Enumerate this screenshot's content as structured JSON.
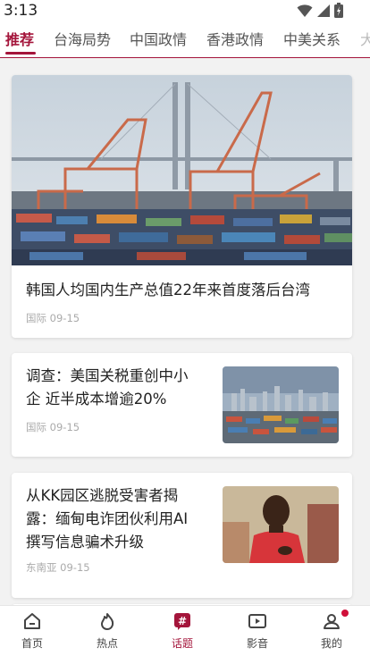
{
  "status": {
    "time": "3:13"
  },
  "tabs": [
    {
      "label": "推荐"
    },
    {
      "label": "台海局势"
    },
    {
      "label": "中国政情"
    },
    {
      "label": "香港政情"
    },
    {
      "label": "中美关系"
    },
    {
      "label": "大"
    }
  ],
  "articles": [
    {
      "title": "韩国人均国内生产总值22年来首度落后台湾",
      "category": "国际",
      "date": "09-15"
    },
    {
      "title_line1": "调查：美国关税重创中小",
      "title_line2": "企 近半成本增逾20%",
      "category": "国际",
      "date": "09-15"
    },
    {
      "title_line1": "从KK园区逃脱受害者揭",
      "title_line2": "露：缅甸电诈团伙利用AI",
      "title_line3": "撰写信息骗术升级",
      "category": "东南亚",
      "date": "09-15"
    }
  ],
  "nav": [
    {
      "label": "首页",
      "icon": "home-icon"
    },
    {
      "label": "热点",
      "icon": "flame-icon"
    },
    {
      "label": "话题",
      "icon": "hashtag-icon"
    },
    {
      "label": "影音",
      "icon": "video-icon"
    },
    {
      "label": "我的",
      "icon": "profile-icon"
    }
  ],
  "colors": {
    "accent": "#a4153b",
    "badge": "#d0103a"
  }
}
